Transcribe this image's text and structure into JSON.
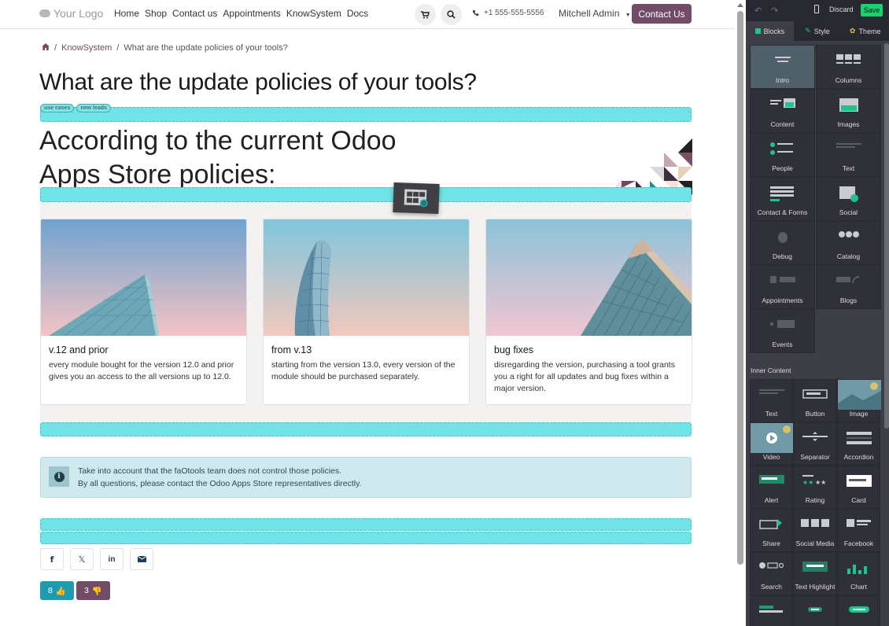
{
  "header": {
    "logo_text": "Your Logo",
    "nav": [
      "Home",
      "Shop",
      "Contact us",
      "Appointments",
      "KnowSystem",
      "Docs"
    ],
    "phone": "+1 555-555-5556",
    "user": "Mitchell Admin",
    "contact_button": "Contact Us"
  },
  "breadcrumb": {
    "section": "KnowSystem",
    "current": "What are the update policies of your tools?"
  },
  "article": {
    "title": "What are the update policies of your tools?",
    "tags": [
      "use cases",
      "new leads"
    ],
    "heading_line1": "According to the current Odoo",
    "heading_line2": "Apps Store policies:",
    "cards": [
      {
        "title": "v.12 and prior",
        "text": "every module bought for the version 12.0 and prior gives you an access to the all versions up to 12.0."
      },
      {
        "title": "from v.13",
        "text": "starting from the version 13.0, every version of the module should be purchased separately."
      },
      {
        "title": "bug fixes",
        "text": "disregarding the version, purchasing a tool grants you a right for all updates and bug fixes within a major version."
      }
    ],
    "alert_line1": "Take into account that the faOtools team does not control those policies.",
    "alert_line2": "By all questions, please contact the Odoo Apps Store representatives directly.",
    "likes": "8",
    "dislikes": "3"
  },
  "editor": {
    "discard": "Discard",
    "save": "Save",
    "tabs": [
      "Blocks",
      "Style",
      "Theme"
    ],
    "blocks": [
      "Intro",
      "Columns",
      "Content",
      "Images",
      "People",
      "Text",
      "Contact & Forms",
      "Social",
      "Debug",
      "Catalog",
      "Appointments",
      "Blogs",
      "Events"
    ],
    "inner_content_label": "Inner Content",
    "inner": [
      "Text",
      "Button",
      "Image",
      "Video",
      "Separator",
      "Accordion",
      "Alert",
      "Rating",
      "Card",
      "Share",
      "Social Media",
      "Facebook",
      "Search",
      "Text Highlight",
      "Chart",
      "",
      "",
      ""
    ]
  },
  "colors": {
    "primary": "#714b67",
    "teal": "#1f9bb0",
    "dropzone": "#6fe3e6",
    "panel_bg": "#3d3e46",
    "save_green": "#1ad170"
  }
}
